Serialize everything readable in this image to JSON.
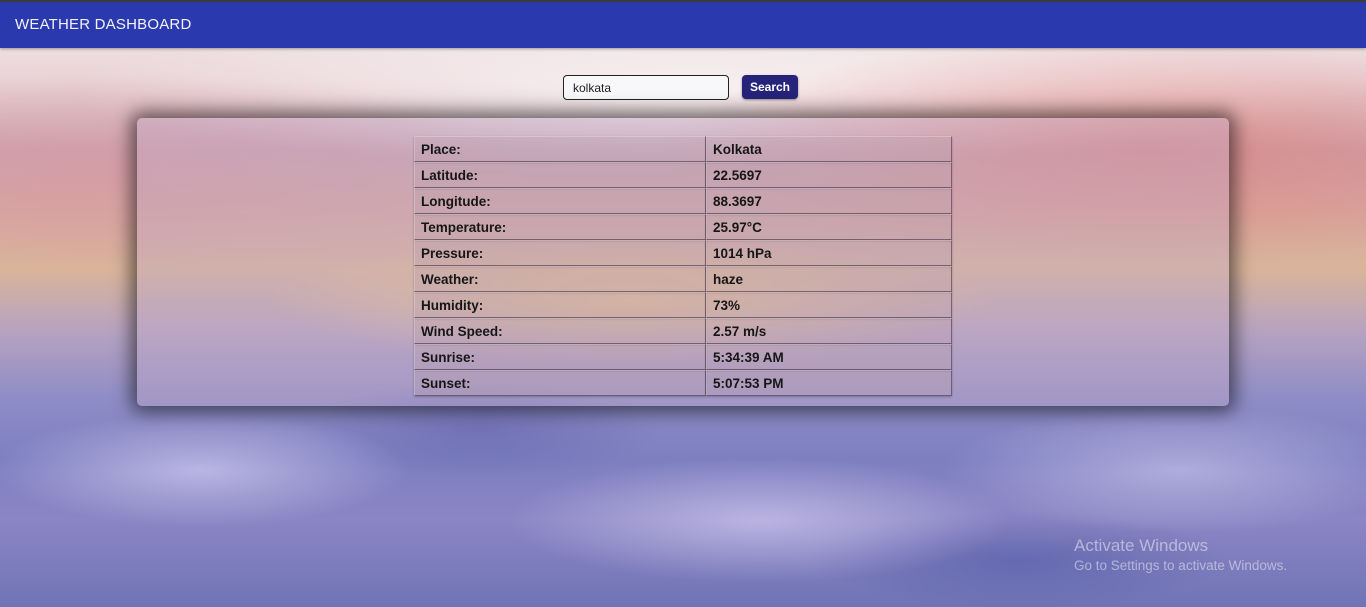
{
  "header": {
    "title": "WEATHER DASHBOARD"
  },
  "search": {
    "value": "kolkata",
    "button_label": "Search"
  },
  "weather": {
    "rows": [
      {
        "label": "Place:",
        "value": "Kolkata"
      },
      {
        "label": "Latitude:",
        "value": "22.5697"
      },
      {
        "label": "Longitude:",
        "value": "88.3697"
      },
      {
        "label": "Temperature:",
        "value": "25.97°C"
      },
      {
        "label": "Pressure:",
        "value": "1014 hPa"
      },
      {
        "label": "Weather:",
        "value": "haze"
      },
      {
        "label": "Humidity:",
        "value": "73%"
      },
      {
        "label": "Wind Speed:",
        "value": "2.57 m/s"
      },
      {
        "label": "Sunrise:",
        "value": "5:34:39 AM"
      },
      {
        "label": "Sunset:",
        "value": "5:07:53 PM"
      }
    ]
  },
  "watermark": {
    "title": "Activate Windows",
    "subtitle": "Go to Settings to activate Windows."
  },
  "colors": {
    "header_bg": "#2a3aae",
    "button_bg": "#25237a"
  }
}
